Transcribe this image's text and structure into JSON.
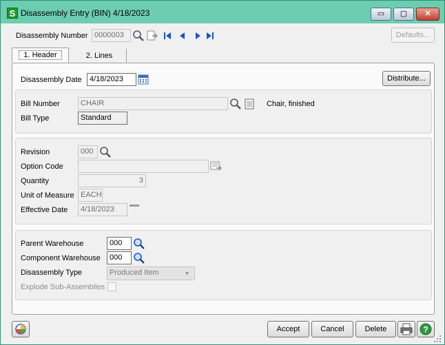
{
  "window": {
    "title": "Disassembly Entry (BIN) 4/18/2023",
    "app_icon": "S",
    "controls": {
      "minimize": "▭",
      "maximize": "▢",
      "close": "✕"
    }
  },
  "toolbar": {
    "disassembly_number_label": "Disassembly Number",
    "disassembly_number_value": "0000003",
    "defaults_label": "Defaults..."
  },
  "tabs": [
    {
      "label": "1. Header",
      "active": true
    },
    {
      "label": "2. Lines",
      "active": false
    }
  ],
  "header": {
    "disassembly_date_label": "Disassembly Date",
    "disassembly_date_value": "4/18/2023",
    "distribute_label": "Distribute..."
  },
  "bill": {
    "bill_number_label": "Bill Number",
    "bill_number_value": "CHAIR",
    "bill_description": "Chair, finished",
    "bill_type_label": "Bill Type",
    "bill_type_value": "Standard"
  },
  "details": {
    "revision_label": "Revision",
    "revision_value": "000",
    "option_code_label": "Option Code",
    "option_code_value": "",
    "quantity_label": "Quantity",
    "quantity_value": "3",
    "uom_label": "Unit of Measure",
    "uom_value": "EACH",
    "effective_date_label": "Effective Date",
    "effective_date_value": "4/18/2023"
  },
  "warehouse": {
    "parent_label": "Parent Warehouse",
    "parent_value": "000",
    "component_label": "Component Warehouse",
    "component_value": "000",
    "type_label": "Disassembly Type",
    "type_value": "Produced Item",
    "explode_label": "Explode Sub-Assemblies"
  },
  "footer": {
    "accept_label": "Accept",
    "cancel_label": "Cancel",
    "delete_label": "Delete"
  },
  "icons": {
    "search": "search-icon",
    "calendar": "calendar-icon",
    "first": "first-record-icon",
    "prev": "previous-record-icon",
    "next": "next-record-icon",
    "last": "last-record-icon",
    "print": "printer-icon",
    "help": "help-icon",
    "color": "#1a56c4"
  }
}
